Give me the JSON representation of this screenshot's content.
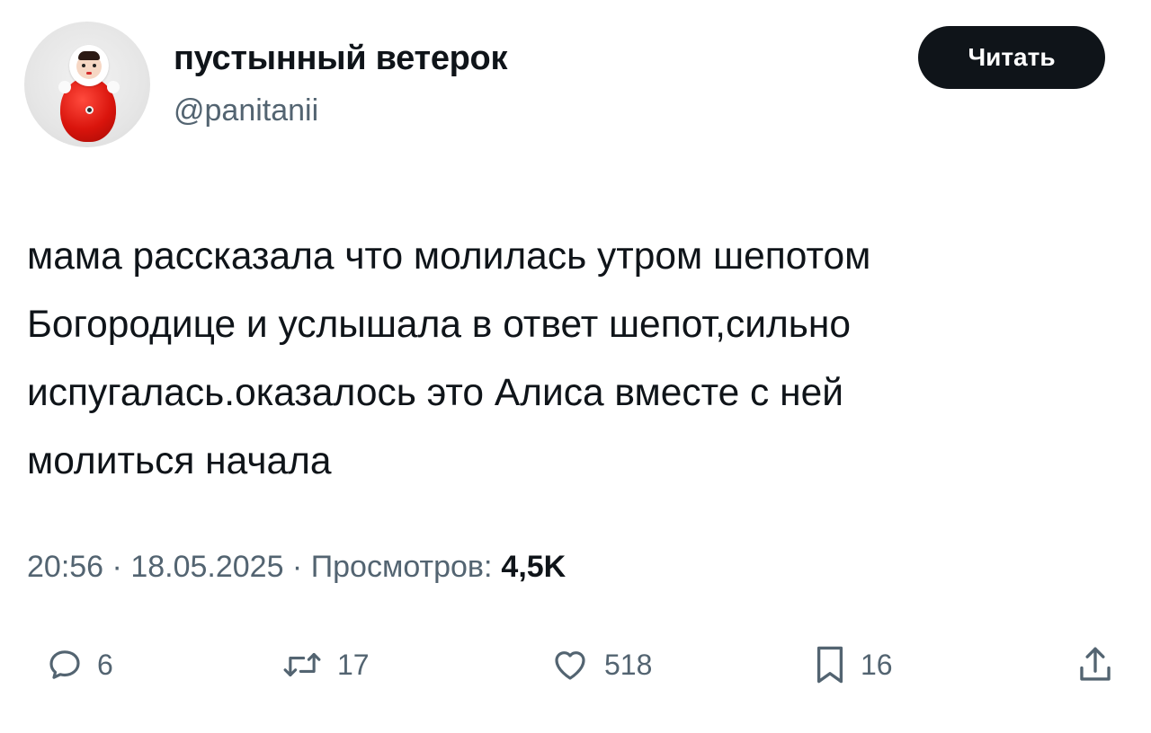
{
  "user": {
    "display_name": "пустынный ветерок",
    "handle": "@panitanii",
    "avatar_icon": "roly-poly-doll-avatar"
  },
  "follow_button_label": "Читать",
  "tweet": {
    "lines": [
      "мама рассказала что молилась утром шепотом",
      "Богородице и услышала в ответ шепот,сильно",
      "испугалась.оказалось это Алиса вместе с ней",
      "молиться начала"
    ]
  },
  "meta": {
    "time": "20:56",
    "date": "18.05.2025",
    "views_label": "Просмотров:",
    "views_count": "4,5K"
  },
  "actions": {
    "reply": {
      "icon": "reply-icon",
      "count": "6"
    },
    "retweet": {
      "icon": "retweet-icon",
      "count": "17"
    },
    "like": {
      "icon": "heart-icon",
      "count": "518"
    },
    "bookmark": {
      "icon": "bookmark-icon",
      "count": "16"
    },
    "share": {
      "icon": "share-icon"
    }
  },
  "colors": {
    "text_primary": "#0f1419",
    "text_secondary": "#536471",
    "button_bg": "#0f1419",
    "button_text": "#ffffff"
  }
}
